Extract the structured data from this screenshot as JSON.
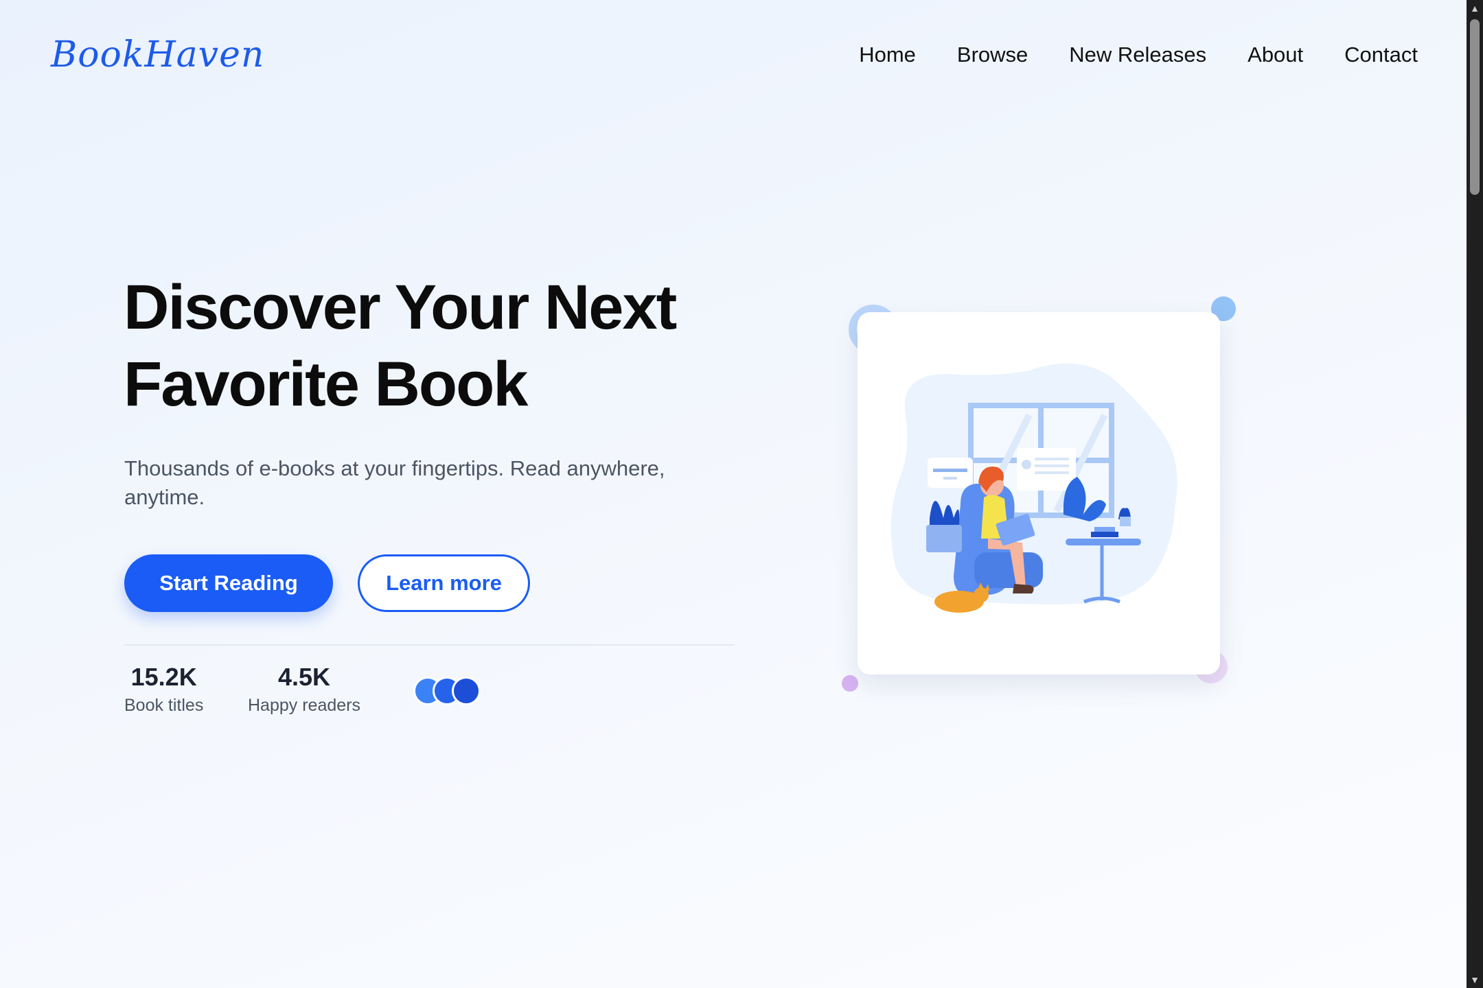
{
  "header": {
    "logo": "BookHaven",
    "nav": [
      "Home",
      "Browse",
      "New Releases",
      "About",
      "Contact"
    ]
  },
  "hero": {
    "title_line1": "Discover Your Next",
    "title_line2": "Favorite Book",
    "subtitle": "Thousands of e-books at your fingertips. Read anywhere, anytime.",
    "primary_button": "Start Reading",
    "secondary_button": "Learn more"
  },
  "stats": [
    {
      "value": "15.2K",
      "label": "Book titles"
    },
    {
      "value": "4.5K",
      "label": "Happy readers"
    }
  ],
  "avatars": [
    "avatar-1",
    "avatar-2",
    "avatar-3"
  ],
  "illustration": {
    "subject": "reading-woman-illustration"
  },
  "colors": {
    "accent": "#1a5cf5",
    "brand": "#1d5be8",
    "text_dark": "#0c0c0c",
    "text_muted": "#4b5563"
  },
  "scrollbar": {
    "up": "▲",
    "down": "▼"
  }
}
